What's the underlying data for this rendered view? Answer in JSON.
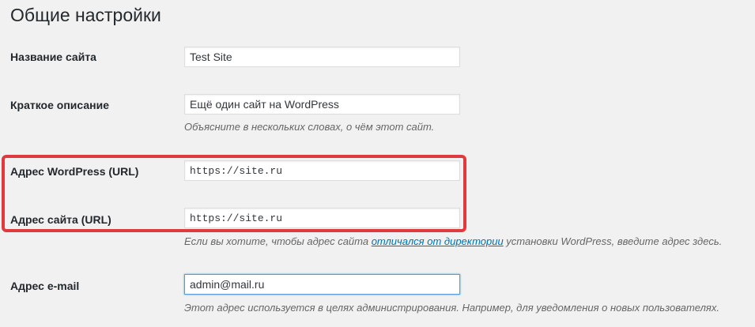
{
  "page": {
    "title": "Общие настройки"
  },
  "settings": {
    "site_title": {
      "label": "Название сайта",
      "value": "Test Site"
    },
    "tagline": {
      "label": "Краткое описание",
      "value": "Ещё один сайт на WordPress",
      "description": "Объясните в нескольких словах, о чём этот сайт."
    },
    "wp_address": {
      "label": "Адрес WordPress (URL)",
      "value": "https://site.ru"
    },
    "site_address": {
      "label": "Адрес сайта (URL)",
      "value": "https://site.ru",
      "description_before": "Если вы хотите, чтобы адрес сайта ",
      "description_link": "отличался от директории",
      "description_after": " установки WordPress, введите адрес здесь."
    },
    "admin_email": {
      "label": "Адрес e-mail",
      "value": "admin@mail.ru",
      "description": "Этот адрес используется в целях администрирования. Например, для уведомления о новых пользователях."
    }
  },
  "colors": {
    "highlight": "#e0393e",
    "link": "#0073aa",
    "focus_border": "#5b9dd9",
    "background": "#f1f1f1"
  }
}
